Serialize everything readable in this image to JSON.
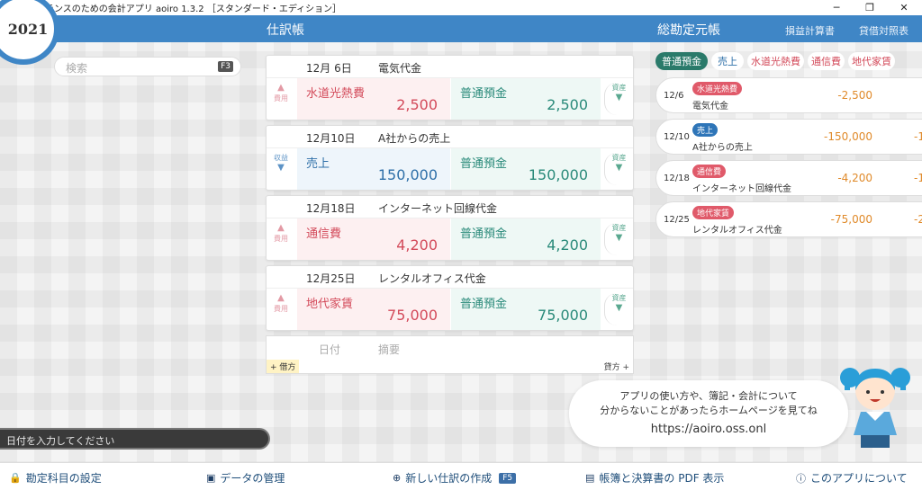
{
  "window": {
    "title": "フリーランスのための会計アプリ aoiro 1.3.2 ［スタンダード・エディション］",
    "minimize": "─",
    "maximize": "❐",
    "close": "✕"
  },
  "header": {
    "year": "2021",
    "journal_title": "仕訳帳",
    "ledger_title": "総勘定元帳",
    "pl_link": "損益計算書",
    "bs_link": "貸借対照表"
  },
  "search": {
    "placeholder": "検索",
    "shortcut": "F3"
  },
  "journal": [
    {
      "date": "12月 6日",
      "desc": "電気代金",
      "debit_side": "費用",
      "debit_account": "水道光熱費",
      "debit_amount": "2,500",
      "credit_account": "普通預金",
      "credit_amount": "2,500",
      "credit_side": "資産"
    },
    {
      "date": "12月10日",
      "desc": "A社からの売上",
      "debit_side": "収益",
      "debit_account": "売上",
      "debit_amount": "150,000",
      "credit_account": "普通預金",
      "credit_amount": "150,000",
      "credit_side": "資産"
    },
    {
      "date": "12月18日",
      "desc": "インターネット回線代金",
      "debit_side": "費用",
      "debit_account": "通信費",
      "debit_amount": "4,200",
      "credit_account": "普通預金",
      "credit_amount": "4,200",
      "credit_side": "資産"
    },
    {
      "date": "12月25日",
      "desc": "レンタルオフィス代金",
      "debit_side": "費用",
      "debit_account": "地代家賃",
      "debit_amount": "75,000",
      "credit_account": "普通預金",
      "credit_amount": "75,000",
      "credit_side": "資産"
    }
  ],
  "new_entry": {
    "date_label": "日付",
    "desc_label": "摘要",
    "debit_tag": "+ 借方",
    "credit_tag": "貸方 +"
  },
  "ledger": {
    "tabs": [
      "普通預金",
      "売上",
      "水道光熱費",
      "通信費",
      "地代家賃"
    ],
    "rows": [
      {
        "date": "12/6",
        "account": "水道光熱費",
        "desc": "電気代金",
        "amount": "-2,500",
        "balance": ""
      },
      {
        "date": "12/10",
        "account": "売上",
        "desc": "A社からの売上",
        "amount": "-150,000",
        "balance": "-1"
      },
      {
        "date": "12/18",
        "account": "通信費",
        "desc": "インターネット回線代金",
        "amount": "-4,200",
        "balance": "-1"
      },
      {
        "date": "12/25",
        "account": "地代家賃",
        "desc": "レンタルオフィス代金",
        "amount": "-75,000",
        "balance": "-2"
      }
    ]
  },
  "help": {
    "line1": "アプリの使い方や、簿記・会計について",
    "line2": "分からないことがあったらホームページを見てね",
    "url": "https://aoiro.oss.onl"
  },
  "date_input": {
    "placeholder": "日付を入力してください"
  },
  "bottom": {
    "accounts": "勘定科目の設定",
    "data": "データの管理",
    "new_entry": "新しい仕訳の作成",
    "new_entry_key": "F5",
    "pdf": "帳簿と決算書の PDF 表示",
    "about": "このアプリについて"
  }
}
